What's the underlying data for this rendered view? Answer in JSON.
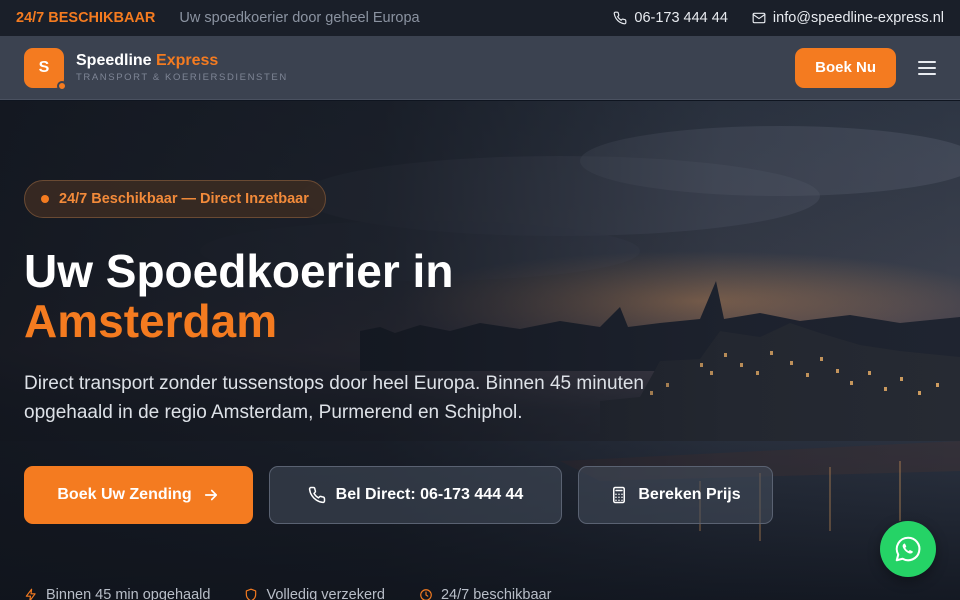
{
  "topbar": {
    "availability": "24/7 BESCHIKBAAR",
    "tagline": "Uw spoedkoerier door geheel Europa",
    "phone": "06-173 444 44",
    "email": "info@speedline-express.nl"
  },
  "nav": {
    "logo_letter": "S",
    "brand_name": "Speedline",
    "brand_accent": "Express",
    "brand_sub": "TRANSPORT & KOERIERSDIENSTEN",
    "book_label": "Boek Nu"
  },
  "hero": {
    "badge": "24/7 Beschikbaar — Direct Inzetbaar",
    "headline_line1": "Uw Spoedkoerier in",
    "headline_city": "Amsterdam",
    "subtext": "Direct transport zonder tussenstops door heel Europa. Binnen 45 minuten opgehaald in de regio Amsterdam, Purmerend en Schiphol.",
    "cta_primary": "Boek Uw Zending",
    "cta_call": "Bel Direct: 06-173 444 44",
    "cta_calc": "Bereken Prijs"
  },
  "features": [
    "Binnen 45 min opgehaald",
    "Volledig verzekerd",
    "24/7 beschikbaar"
  ],
  "colors": {
    "accent": "#f47b20",
    "topbar_bg": "#1a1f29",
    "nav_bg": "#3b4250",
    "whatsapp": "#25d366"
  },
  "icons": {
    "phone": "phone-icon",
    "email": "mail-icon",
    "menu": "hamburger-menu-icon",
    "arrow": "arrow-right-icon",
    "calculator": "calculator-icon",
    "bolt": "lightning-icon",
    "shield": "shield-icon",
    "clock": "clock-icon",
    "whatsapp": "whatsapp-icon"
  }
}
